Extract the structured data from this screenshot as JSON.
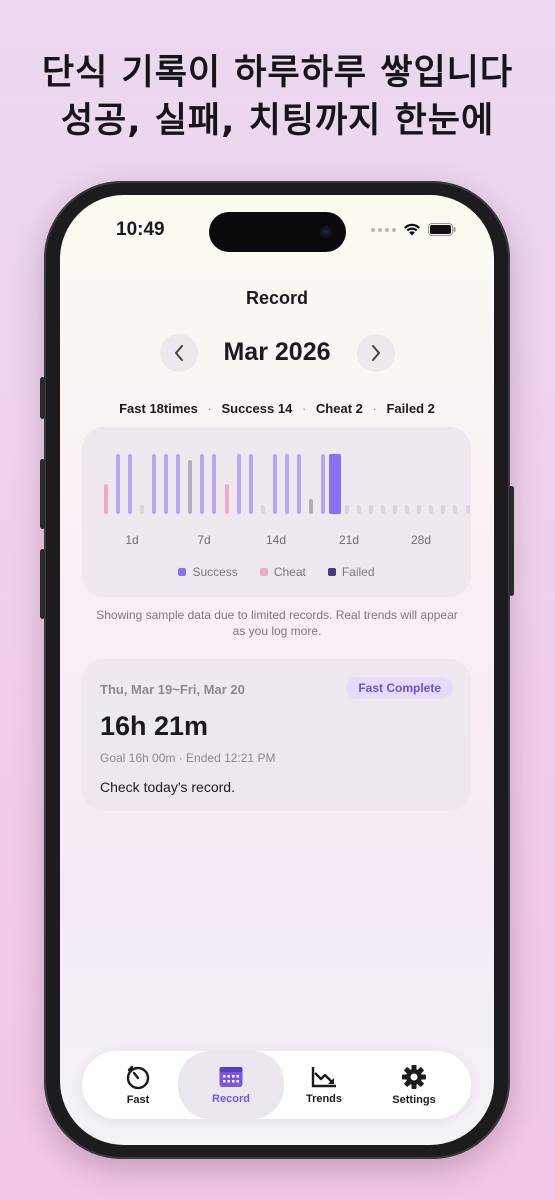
{
  "headline": {
    "line1": "단식 기록이 하루하루 쌓입니다",
    "line2": "성공, 실패, 치팅까지 한눈에"
  },
  "status_bar": {
    "time": "10:49"
  },
  "screen": {
    "title": "Record",
    "month": "Mar 2026",
    "stats": {
      "fast": "Fast 18times",
      "success": "Success 14",
      "cheat": "Cheat 2",
      "failed": "Failed 2",
      "separator": "·"
    },
    "note": "Showing sample data due to limited records. Real trends will appear as you log more."
  },
  "colors": {
    "success": "#8b6ff2",
    "success_light": "#b9a6f5",
    "cheat": "#f2a9c9",
    "failed": "#4b3a7a",
    "empty": "#dcd6de",
    "accent": "#7a55e0"
  },
  "chart_data": {
    "type": "bar",
    "x_ticks": [
      "1d",
      "7d",
      "14d",
      "21d",
      "28d"
    ],
    "legend": [
      "Success",
      "Cheat",
      "Failed"
    ],
    "legend_position": "bottom",
    "days": [
      {
        "day": 1,
        "status": "cheat",
        "level": 0.5
      },
      {
        "day": 2,
        "status": "success",
        "level": 1.0
      },
      {
        "day": 3,
        "status": "success",
        "level": 1.0
      },
      {
        "day": 4,
        "status": "none",
        "level": 0.15
      },
      {
        "day": 5,
        "status": "success",
        "level": 1.0
      },
      {
        "day": 6,
        "status": "success",
        "level": 1.0
      },
      {
        "day": 7,
        "status": "success",
        "level": 1.0
      },
      {
        "day": 8,
        "status": "failed",
        "level": 0.9
      },
      {
        "day": 9,
        "status": "success",
        "level": 1.0
      },
      {
        "day": 10,
        "status": "success",
        "level": 1.0
      },
      {
        "day": 11,
        "status": "cheat",
        "level": 0.5
      },
      {
        "day": 12,
        "status": "success",
        "level": 1.0
      },
      {
        "day": 13,
        "status": "success",
        "level": 1.0
      },
      {
        "day": 14,
        "status": "none",
        "level": 0.15
      },
      {
        "day": 15,
        "status": "success",
        "level": 1.0
      },
      {
        "day": 16,
        "status": "success",
        "level": 1.0
      },
      {
        "day": 17,
        "status": "success",
        "level": 1.0
      },
      {
        "day": 18,
        "status": "failed",
        "level": 0.25
      },
      {
        "day": 19,
        "status": "success",
        "level": 1.0
      },
      {
        "day": 20,
        "status": "success",
        "level": 1.0,
        "selected": true
      },
      {
        "day": 21,
        "status": "none",
        "level": 0.15
      },
      {
        "day": 22,
        "status": "none",
        "level": 0.15
      },
      {
        "day": 23,
        "status": "none",
        "level": 0.15
      },
      {
        "day": 24,
        "status": "none",
        "level": 0.15
      },
      {
        "day": 25,
        "status": "none",
        "level": 0.15
      },
      {
        "day": 26,
        "status": "none",
        "level": 0.15
      },
      {
        "day": 27,
        "status": "none",
        "level": 0.15
      },
      {
        "day": 28,
        "status": "none",
        "level": 0.15
      },
      {
        "day": 29,
        "status": "none",
        "level": 0.15
      },
      {
        "day": 30,
        "status": "none",
        "level": 0.15
      },
      {
        "day": 31,
        "status": "none",
        "level": 0.15
      }
    ]
  },
  "record_card": {
    "date_range": "Thu, Mar 19~Fri, Mar 20",
    "badge": "Fast Complete",
    "duration": "16h 21m",
    "goal_line": "Goal 16h 00m · Ended 12:21 PM",
    "message": "Check today's record."
  },
  "tabs": [
    {
      "label": "Fast",
      "icon": "timer-icon"
    },
    {
      "label": "Record",
      "icon": "calendar-icon",
      "active": true
    },
    {
      "label": "Trends",
      "icon": "trend-chart-icon"
    },
    {
      "label": "Settings",
      "icon": "gear-icon"
    }
  ]
}
